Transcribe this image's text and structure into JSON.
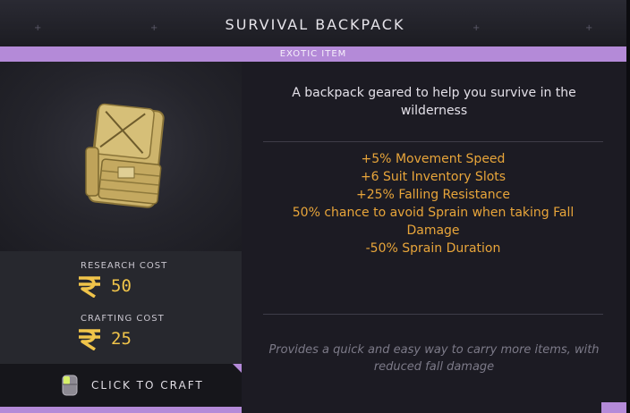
{
  "header": {
    "title": "SURVIVAL BACKPACK",
    "rarity": "EXOTIC ITEM"
  },
  "item": {
    "icon": "backpack-icon",
    "description": "A backpack geared to help you survive in the wilderness",
    "effects": [
      "+5% Movement Speed",
      "+6 Suit Inventory Slots",
      "+25% Falling Resistance",
      "50% chance to avoid Sprain when taking Fall Damage",
      "-50% Sprain Duration"
    ],
    "flavor_text": "Provides a quick and easy way to carry more items, with reduced fall damage"
  },
  "costs": {
    "research_label": "RESEARCH COST",
    "research_value": "50",
    "crafting_label": "CRAFTING COST",
    "crafting_value": "25",
    "currency_icon": "rupee-currency-icon"
  },
  "craft_button": {
    "label": "CLICK TO CRAFT",
    "icon": "mouse-icon"
  },
  "colors": {
    "accent": "#b48ad8",
    "effect_text": "#e8a53a",
    "cost_text": "#f0c44a",
    "background": "#141318"
  }
}
